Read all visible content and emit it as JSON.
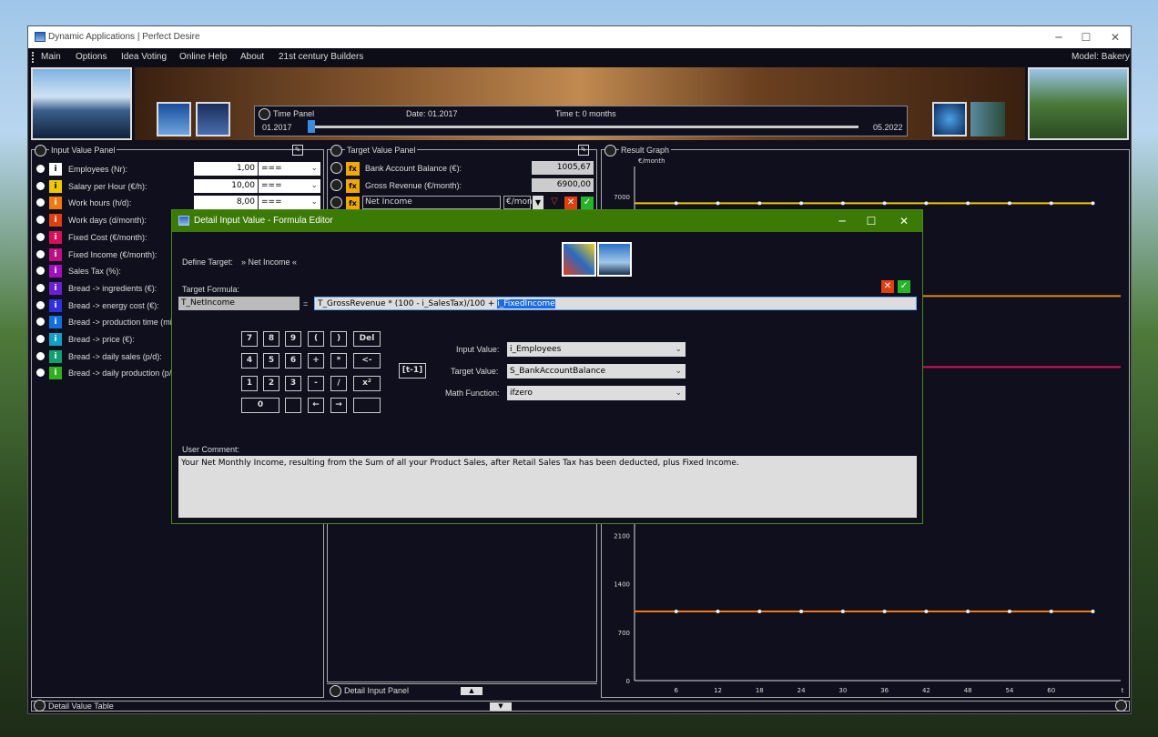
{
  "window": {
    "title": "Dynamic Applications | Perfect Desire",
    "min": "─",
    "max": "☐",
    "close": "✕"
  },
  "menu": {
    "items": [
      "Main",
      "Options",
      "Idea Voting",
      "Online Help",
      "About",
      "21st century Builders"
    ],
    "model": "Model:  Bakery"
  },
  "time_panel": {
    "title": "Time Panel",
    "date": "Date:  01.2017",
    "time": "Time t:   0  months",
    "start": "01.2017",
    "end": "05.2022",
    "progress": 0
  },
  "input_panel": {
    "title": "Input Value Panel",
    "rows": [
      {
        "label": "Employees (Nr):",
        "value": "1,00",
        "sel": "===",
        "color": "#ffffff",
        "fg": "#000"
      },
      {
        "label": "Salary per Hour (€/h):",
        "value": "10,00",
        "sel": "===",
        "color": "#f1c800",
        "fg": "#000"
      },
      {
        "label": "Work hours (h/d):",
        "value": "8,00",
        "sel": "===",
        "color": "#f07a10",
        "fg": "#fff"
      },
      {
        "label": "Work days (d/month):",
        "color": "#e04010",
        "fg": "#fff"
      },
      {
        "label": "Fixed Cost (€/month):",
        "color": "#d8105a",
        "fg": "#fff"
      },
      {
        "label": "Fixed Income (€/month):",
        "color": "#c01080",
        "fg": "#fff"
      },
      {
        "label": "Sales Tax (%):",
        "color": "#a010c0",
        "fg": "#fff"
      },
      {
        "label": "Bread -> ingredients (€):",
        "color": "#6a20d0",
        "fg": "#fff"
      },
      {
        "label": "Bread -> energy cost (€):",
        "color": "#3030e0",
        "fg": "#fff"
      },
      {
        "label": "Bread -> production time (min.",
        "color": "#1070e0",
        "fg": "#fff"
      },
      {
        "label": "Bread -> price (€):",
        "color": "#10a0c8",
        "fg": "#fff"
      },
      {
        "label": "Bread -> daily sales (p/d):",
        "color": "#10a070",
        "fg": "#fff"
      },
      {
        "label": "Bread -> daily production (p/d",
        "color": "#30b020",
        "fg": "#fff"
      }
    ]
  },
  "target_panel": {
    "title": "Target Value Panel",
    "rows": [
      {
        "label": "Bank Account Balance (€):",
        "value": "1005,67"
      },
      {
        "label": "Gross Revenue (€/month):",
        "value": "6900,00"
      }
    ],
    "edit_name": "Net Income",
    "edit_unit": "€/mon"
  },
  "graph": {
    "title": "Result Graph",
    "unit": "€/month",
    "y_visible": [
      "7000",
      "2100",
      "1400",
      "700",
      "0"
    ],
    "x_ticks": [
      "6",
      "12",
      "18",
      "24",
      "30",
      "36",
      "42",
      "48",
      "54",
      "60",
      "t"
    ]
  },
  "chart_data": {
    "type": "line",
    "xlabel": "t",
    "ylabel": "€/month",
    "x": [
      0,
      6,
      12,
      18,
      24,
      30,
      36,
      42,
      48,
      54,
      60,
      66
    ],
    "series": [
      {
        "values": [
          6900,
          6900,
          6900,
          6900,
          6900,
          6900,
          6900,
          6900,
          6900,
          6900,
          6900,
          6900
        ],
        "color": "#f1c800"
      },
      {
        "values": [
          1000,
          1000,
          1000,
          1000,
          1000,
          1000,
          1000,
          1000,
          1000,
          1000,
          1000,
          1000
        ],
        "color": "#f07a10"
      }
    ],
    "ylim": [
      0,
      7300
    ],
    "xlim": [
      0,
      70
    ]
  },
  "detail_input_panel": {
    "title": "Detail Input Panel"
  },
  "detail_value_table": {
    "title": "Detail Value Table"
  },
  "dialog": {
    "title": "Detail Input Value - Formula Editor",
    "define_target": "Define Target:",
    "target_name": "» Net Income «",
    "target_formula": "Target Formula:",
    "formula_lhs": "T_NetIncome",
    "equals": "=",
    "formula_rhs": "T_GrossRevenue * (100 - i_SalesTax)/100 + ",
    "formula_sel": "i_FixedIncome",
    "keys": {
      "r1": [
        "7",
        "8",
        "9",
        "(",
        ")",
        "Del"
      ],
      "r2": [
        "4",
        "5",
        "6",
        "+",
        "<-"
      ],
      "r2b": "*",
      "r3": [
        "1",
        "2",
        "3",
        "-",
        "/",
        "x²"
      ],
      "r4": [
        "0",
        "",
        "←",
        "→",
        ""
      ]
    },
    "bracket_btn": "[t-1]",
    "input_value_label": "Input Value:",
    "input_value": "i_Employees",
    "target_value_label": "Target Value:",
    "target_value": "S_BankAccountBalance",
    "math_label": "Math Function:",
    "math_value": "ifzero",
    "comment_label": "User Comment:",
    "comment": "Your Net Monthly Income, resulting from the Sum of all your Product Sales, after Retail Sales Tax has been deducted, plus Fixed Income."
  }
}
